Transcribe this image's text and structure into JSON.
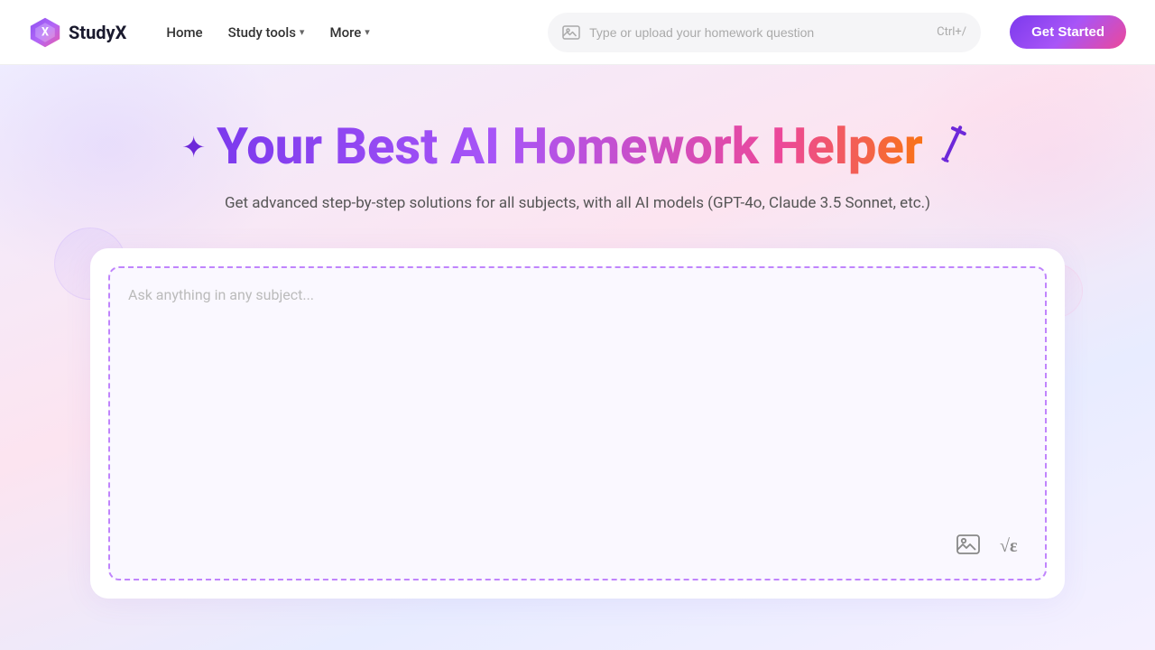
{
  "navbar": {
    "logo_text": "StudyX",
    "home_label": "Home",
    "study_tools_label": "Study tools",
    "more_label": "More",
    "search_placeholder": "Type or upload your homework question",
    "search_shortcut": "Ctrl+/",
    "get_started_label": "Get Started"
  },
  "hero": {
    "sparkle_left": "✦",
    "title": "Your Best AI Homework Helper",
    "pencil_icon": "✏",
    "subtitle": "Get advanced step-by-step solutions for all subjects, with all AI models (GPT-4o, Claude 3.5 Sonnet, etc.)",
    "textarea_placeholder": "Ask anything in any subject..."
  },
  "toolbar": {
    "image_icon": "🖼",
    "formula_icon": "√"
  }
}
